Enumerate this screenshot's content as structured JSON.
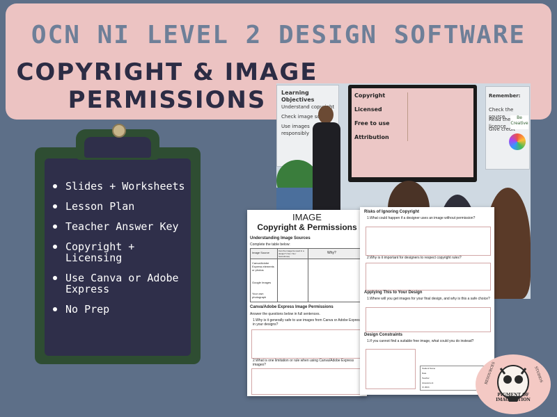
{
  "header": {
    "title_top": "OCN NI Level 2 Design Software",
    "title_main_line1": "Copyright & Image",
    "title_main_line2": "Permissions"
  },
  "features": [
    "Slides + Worksheets",
    "Lesson Plan",
    "Teacher Answer Key",
    "Copyright + Licensing",
    "Use Canva or Adobe Express",
    "No Prep"
  ],
  "photo": {
    "board_left_title": "Learning Objectives",
    "board_left_items": [
      "Understand copyright",
      "Check image sources",
      "Use images responsibly"
    ],
    "tv_items": [
      "Copyright",
      "Licensed",
      "Free to use",
      "Attribution"
    ],
    "board_right_title": "Remember:",
    "board_right_items": [
      "Check the source",
      "Read the licence",
      "Give credit"
    ],
    "board_right_badge": "Be Creative"
  },
  "worksheet_left": {
    "heading_small": "IMAGE",
    "heading": "Copyright & Permissions",
    "section1": "Understanding Image Sources",
    "section1_instr": "Complete the table below:",
    "table_headers": [
      "Image Source",
      "Can the image be used in a design? (Yes / No / Sometimes)",
      "Why?"
    ],
    "table_rows": [
      "Canva/Adobe Express elements or photos",
      "Google Images",
      "Your own photograph"
    ],
    "section2": "Canva/Adobe Express Image Permissions",
    "section2_instr": "Answer the questions below in full sentences.",
    "q1": "1.Why is it generally safe to use images from Canva or Adobe Express in your designs?",
    "q2": "2.What is one limitation or rule when using Canva/Adobe Express images?"
  },
  "worksheet_right": {
    "section1": "Risks of Ignoring Copyright",
    "q1": "1.What could happen if a designer uses an image without permission?",
    "q2": "2.Why is it important for designers to respect copyright rules?",
    "section2": "Applying This to Your Design",
    "q3": "1.Where will you get images for your final design, and why is this a safe choice?",
    "section3": "Design Constraints",
    "q4": "1.If you cannot find a suitable free image, what could you do instead?",
    "footer_labels": [
      "Student Name",
      "Date",
      "Teacher",
      "Assessment",
      "CI 2024"
    ]
  },
  "logo": {
    "text": "PIGMENT OF IMAGINATION",
    "ring_left": "RESOURCES",
    "ring_right": "STUDIOS"
  },
  "colors": {
    "background": "#5d6f88",
    "banner": "#ecc3c2",
    "title_top": "#6e7f98",
    "title_main": "#2c2c44",
    "clipboard_frame": "#2e4d32",
    "clipboard_board": "#2f2f4a"
  }
}
